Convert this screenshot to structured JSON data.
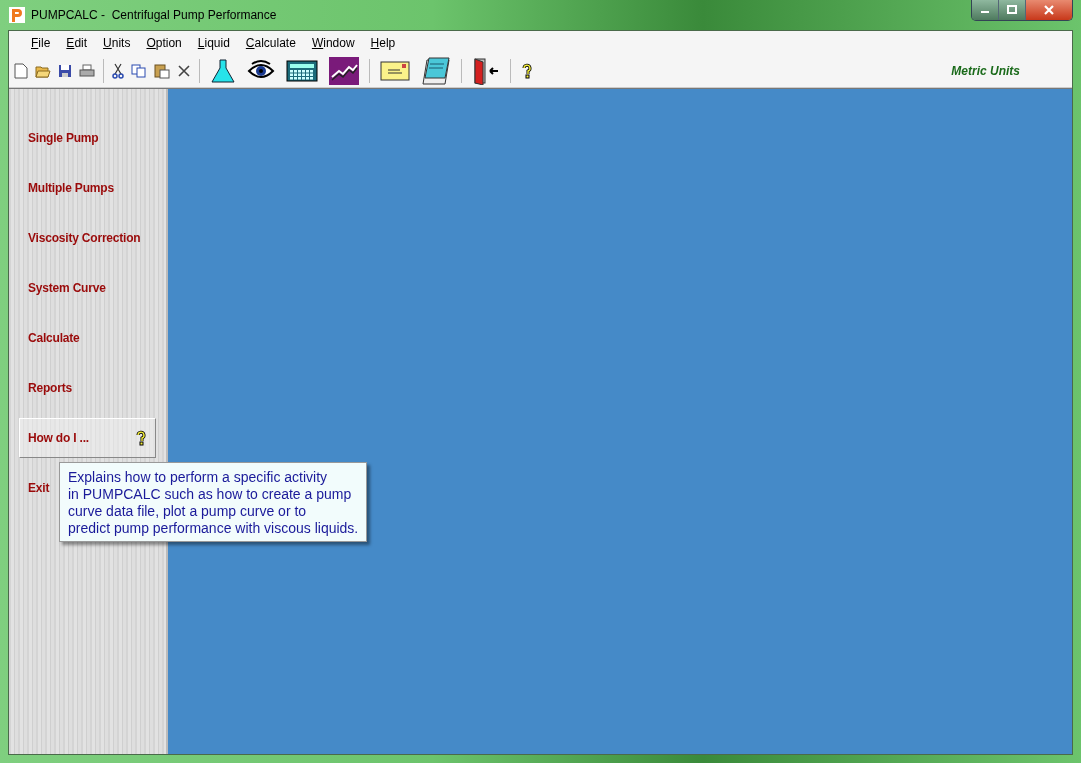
{
  "window": {
    "title": "PUMPCALC -  Centrifugal Pump Performance"
  },
  "menu": [
    "File",
    "Edit",
    "Units",
    "Option",
    "Liquid",
    "Calculate",
    "Window",
    "Help"
  ],
  "toolbar": {
    "groups": [
      [
        {
          "kind": "new"
        },
        {
          "kind": "open"
        },
        {
          "kind": "save"
        },
        {
          "kind": "print"
        }
      ],
      [
        {
          "kind": "cut"
        },
        {
          "kind": "copy"
        },
        {
          "kind": "paste"
        },
        {
          "kind": "delete"
        }
      ],
      [
        {
          "kind": "flask"
        },
        {
          "kind": "eye"
        },
        {
          "kind": "calculator"
        },
        {
          "kind": "chart"
        }
      ],
      [
        {
          "kind": "envelope"
        },
        {
          "kind": "notepad"
        }
      ],
      [
        {
          "kind": "exit"
        }
      ],
      [
        {
          "kind": "help"
        }
      ]
    ],
    "units_label": "Metric Units"
  },
  "sidebar": {
    "items": [
      {
        "label": "Single Pump",
        "selected": false
      },
      {
        "label": "Multiple Pumps",
        "selected": false
      },
      {
        "label": "Viscosity Correction",
        "selected": false
      },
      {
        "label": "System Curve",
        "selected": false
      },
      {
        "label": "Calculate",
        "selected": false
      },
      {
        "label": "Reports",
        "selected": false
      },
      {
        "label": "How do I ...",
        "selected": true
      },
      {
        "label": "Exit",
        "selected": false
      }
    ]
  },
  "tooltip": {
    "lines": [
      "Explains how to perform a specific activity",
      "in PUMPCALC such as how to create a pump",
      "curve data file, plot a pump curve or to",
      "predict pump performance with viscous liquids."
    ]
  }
}
